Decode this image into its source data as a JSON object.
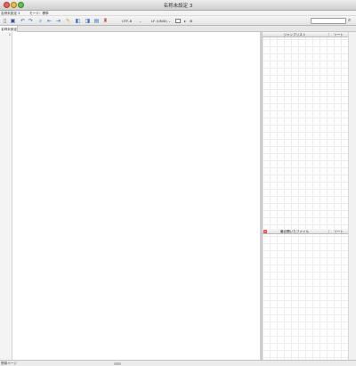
{
  "window": {
    "title": "名称未設定 3"
  },
  "modebar": {
    "doc_label": "名称未設定 3",
    "mode_label": "モード：標準"
  },
  "toolbar": {
    "encoding": "UTF-8",
    "line_ending": "LF (UNIX)",
    "search": {
      "value": "",
      "placeholder": ""
    }
  },
  "tabs": [
    {
      "label": "名称未設定"
    }
  ],
  "editor": {
    "line_numbers": [
      "1"
    ],
    "content": ""
  },
  "jump_panel": {
    "title": "ジャンプリスト",
    "sort_label": "ソート"
  },
  "recent_panel": {
    "title": "最近開いたファイル",
    "sort_label": "ソート"
  },
  "status": {
    "text": "簡易ページ"
  },
  "colors": {
    "close": "#ef5f54",
    "minimize": "#f3bb3a",
    "maximize": "#5fc24a",
    "clear_button": "#e0493f"
  }
}
